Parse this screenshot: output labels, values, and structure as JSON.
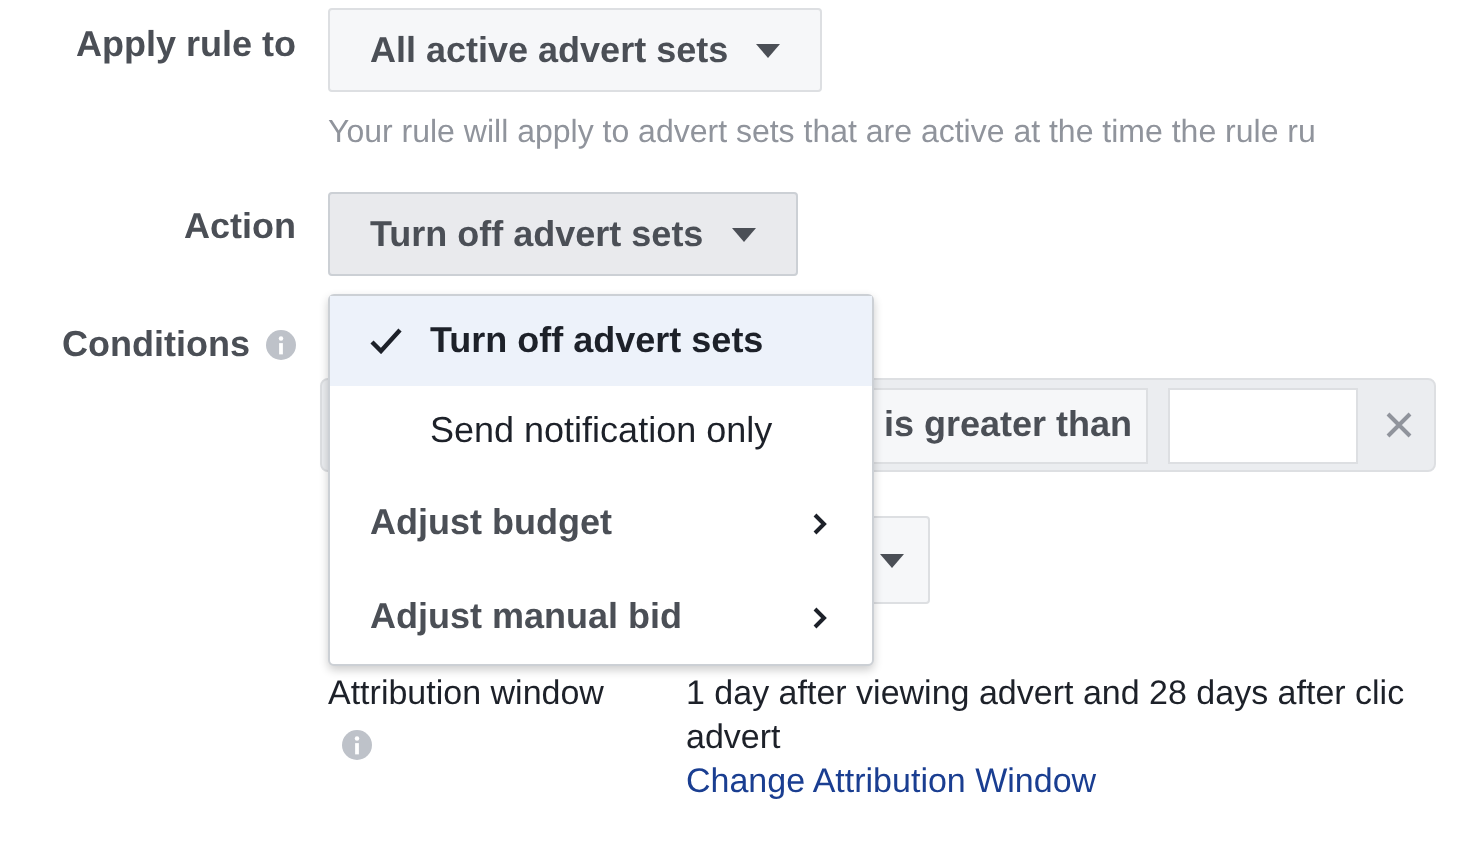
{
  "apply_rule": {
    "label": "Apply rule to",
    "value": "All active advert sets",
    "hint": "Your rule will apply to advert sets that are active at the time the rule ru"
  },
  "action": {
    "label": "Action",
    "value": "Turn off advert sets",
    "expanded": true,
    "menu": [
      {
        "label": "Turn off advert sets",
        "kind": "option",
        "selected": true
      },
      {
        "label": "Send notification only",
        "kind": "option",
        "selected": false
      },
      {
        "label": "Adjust budget",
        "kind": "submenu"
      },
      {
        "label": "Adjust manual bid",
        "kind": "submenu"
      }
    ]
  },
  "conditions": {
    "label": "Conditions",
    "operator": "is greater than"
  },
  "attribution": {
    "label": "Attribution window",
    "lines": [
      "1 day after viewing advert and 28 days after clic",
      "advert"
    ],
    "link": "Change Attribution Window"
  }
}
